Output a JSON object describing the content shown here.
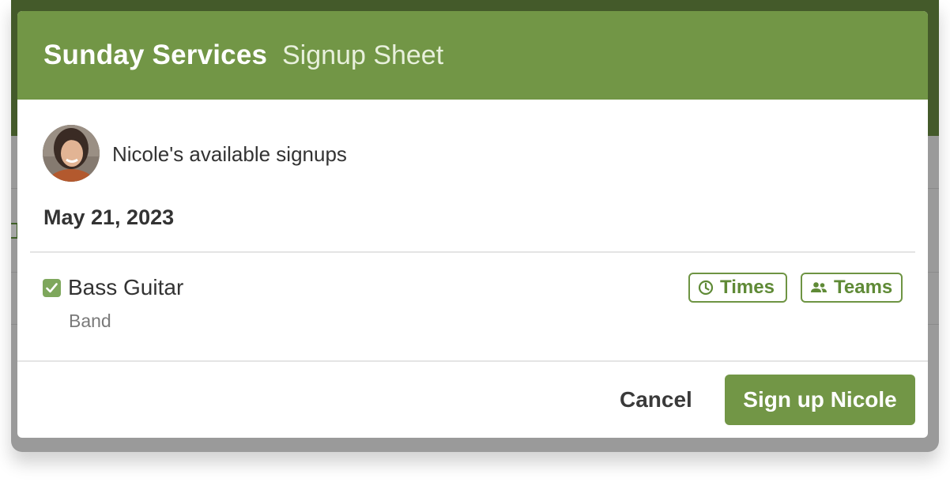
{
  "header": {
    "title": "Sunday Services",
    "subtitle": "Signup Sheet"
  },
  "person": {
    "available_label": "Nicole's available signups"
  },
  "date": "May 21, 2023",
  "signup_item": {
    "checked": true,
    "title": "Bass Guitar",
    "team": "Band",
    "times_label": "Times",
    "teams_label": "Teams"
  },
  "footer": {
    "cancel_label": "Cancel",
    "submit_label": "Sign up Nicole"
  },
  "icons": {
    "times": "clock-icon",
    "teams": "people-icon",
    "checkbox": "check-icon"
  },
  "colors": {
    "brand_green": "#729646",
    "accent_green": "#5f8a36",
    "checkbox_green": "#7ea75c",
    "text_dark": "#333333",
    "text_muted": "#7a7a7a"
  }
}
